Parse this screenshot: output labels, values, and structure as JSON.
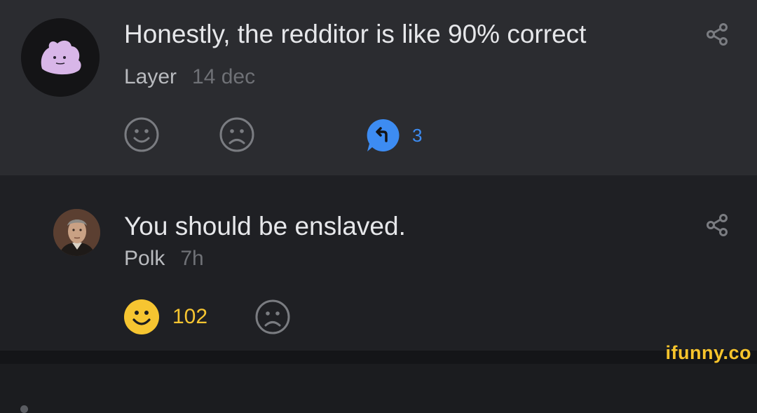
{
  "comments": [
    {
      "text": "Honestly, the redditor is like 90% correct",
      "author": "Layer",
      "time": "14 dec",
      "reply_count": "3",
      "avatar_icon": "ditto-avatar",
      "share_icon": "share-icon"
    },
    {
      "text": "You should be enslaved.",
      "author": "Polk",
      "time": "7h",
      "like_count": "102",
      "avatar_icon": "portrait-avatar",
      "share_icon": "share-icon"
    }
  ],
  "watermark": "ifunny.co",
  "colors": {
    "accent_blue": "#3d8cf2",
    "like_yellow": "#f6c531",
    "icon_gray": "#7a7c81",
    "text_primary": "#e6e7ea"
  }
}
